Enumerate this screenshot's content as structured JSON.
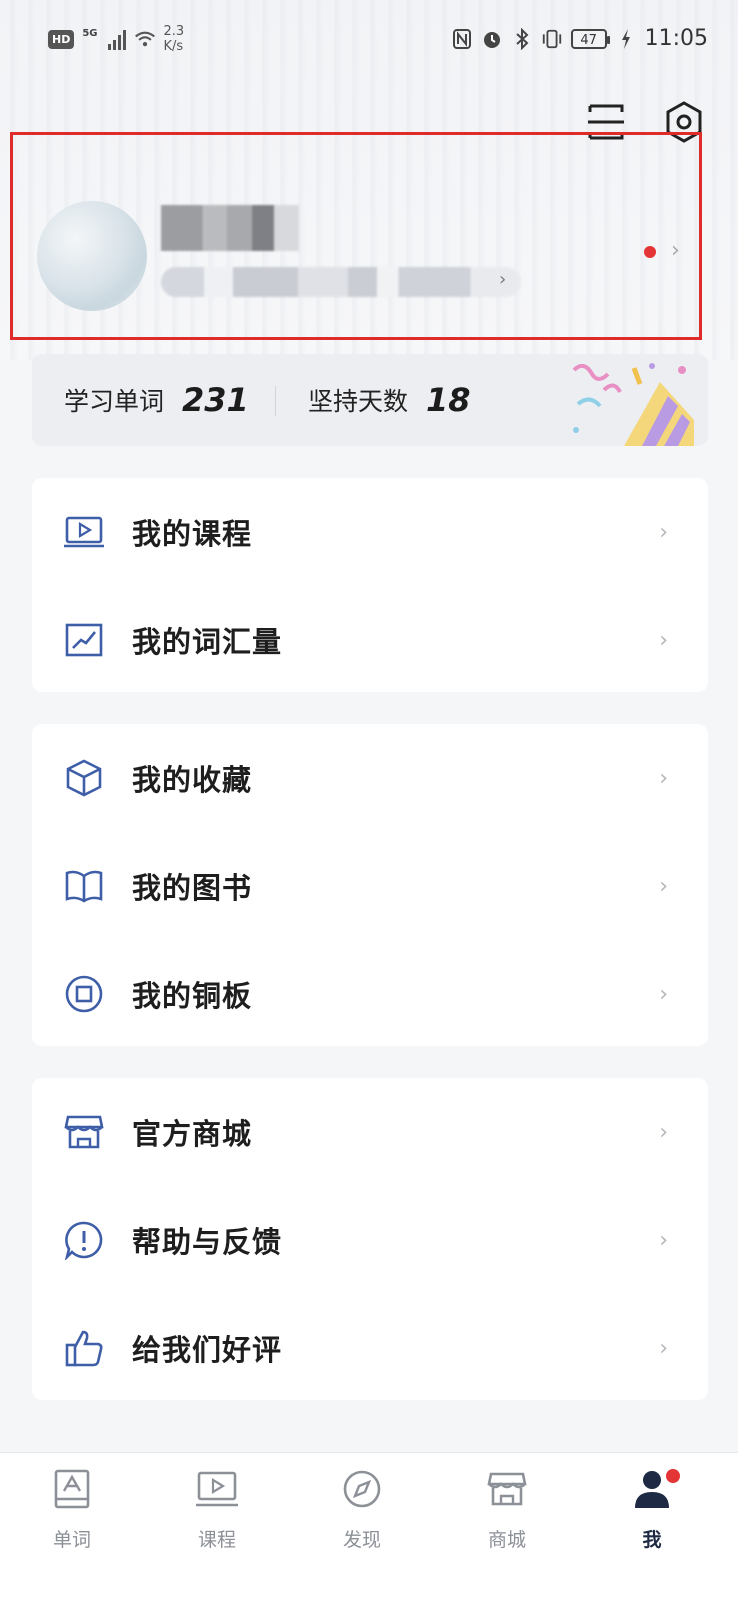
{
  "status_bar": {
    "network_badge": "HD",
    "signal_type": "5G",
    "speed_value": "2.3",
    "speed_unit": "K/s",
    "battery": "47",
    "time": "11:05"
  },
  "header": {
    "scan_icon": "scan-icon",
    "settings_icon": "settings-hexagon-icon"
  },
  "profile": {
    "notification_color": "#e33535",
    "highlight_border_color": "#e02b2b"
  },
  "stats": {
    "words_label": "学习单词",
    "words_value": "231",
    "days_label": "坚持天数",
    "days_value": "18"
  },
  "menu": {
    "group1": [
      {
        "label": "我的课程",
        "icon": "play-screen-icon"
      },
      {
        "label": "我的词汇量",
        "icon": "trend-chart-icon"
      }
    ],
    "group2": [
      {
        "label": "我的收藏",
        "icon": "cube-icon"
      },
      {
        "label": "我的图书",
        "icon": "book-icon"
      },
      {
        "label": "我的铜板",
        "icon": "coin-icon"
      }
    ],
    "group3": [
      {
        "label": "官方商城",
        "icon": "store-icon"
      },
      {
        "label": "帮助与反馈",
        "icon": "help-exclaim-icon"
      },
      {
        "label": "给我们好评",
        "icon": "thumbs-up-icon"
      }
    ]
  },
  "tabbar": {
    "tabs": [
      {
        "label": "单词",
        "icon": "word-card-icon"
      },
      {
        "label": "课程",
        "icon": "course-screen-icon"
      },
      {
        "label": "发现",
        "icon": "compass-icon"
      },
      {
        "label": "商城",
        "icon": "shop-icon"
      },
      {
        "label": "我",
        "icon": "profile-person-icon"
      }
    ],
    "active_index": 4,
    "accent_color": "#1e2a44"
  }
}
